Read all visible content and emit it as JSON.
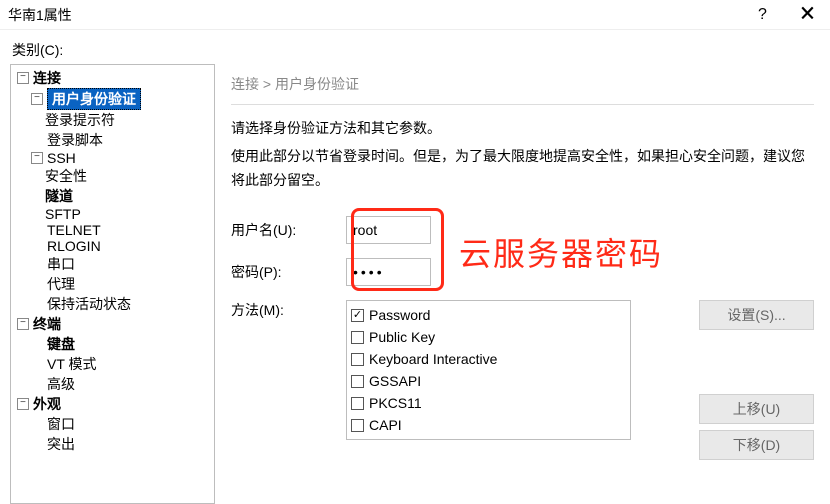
{
  "window": {
    "title": "华南1属性",
    "help": "?",
    "close": "🗙"
  },
  "category_label": "类别(C):",
  "tree": {
    "connection": "连接",
    "user_auth": "用户身份验证",
    "login_prompt": "登录提示符",
    "login_script": "登录脚本",
    "ssh": "SSH",
    "security": "安全性",
    "tunnel": "隧道",
    "sftp": "SFTP",
    "telnet": "TELNET",
    "rlogin": "RLOGIN",
    "serial": "串口",
    "proxy": "代理",
    "keepalive": "保持活动状态",
    "terminal": "终端",
    "keyboard": "键盘",
    "vtmode": "VT 模式",
    "advanced": "高级",
    "appearance": "外观",
    "window": "窗口",
    "highlight": "突出"
  },
  "breadcrumb": "连接 > 用户身份验证",
  "desc1": "请选择身份验证方法和其它参数。",
  "desc2": "使用此部分以节省登录时间。但是，为了最大限度地提高安全性，如果担心安全问题，建议您将此部分留空。",
  "form": {
    "username_label": "用户名(U):",
    "username_value": "root",
    "password_label": "密码(P):",
    "password_value": "••••",
    "methods_label": "方法(M):"
  },
  "annotation": "云服务器密码",
  "methods": {
    "password": "Password",
    "publickey": "Public Key",
    "kbi": "Keyboard Interactive",
    "gssapi": "GSSAPI",
    "pkcs11": "PKCS11",
    "capi": "CAPI"
  },
  "buttons": {
    "setup": "设置(S)...",
    "moveup": "上移(U)",
    "movedown": "下移(D)"
  }
}
